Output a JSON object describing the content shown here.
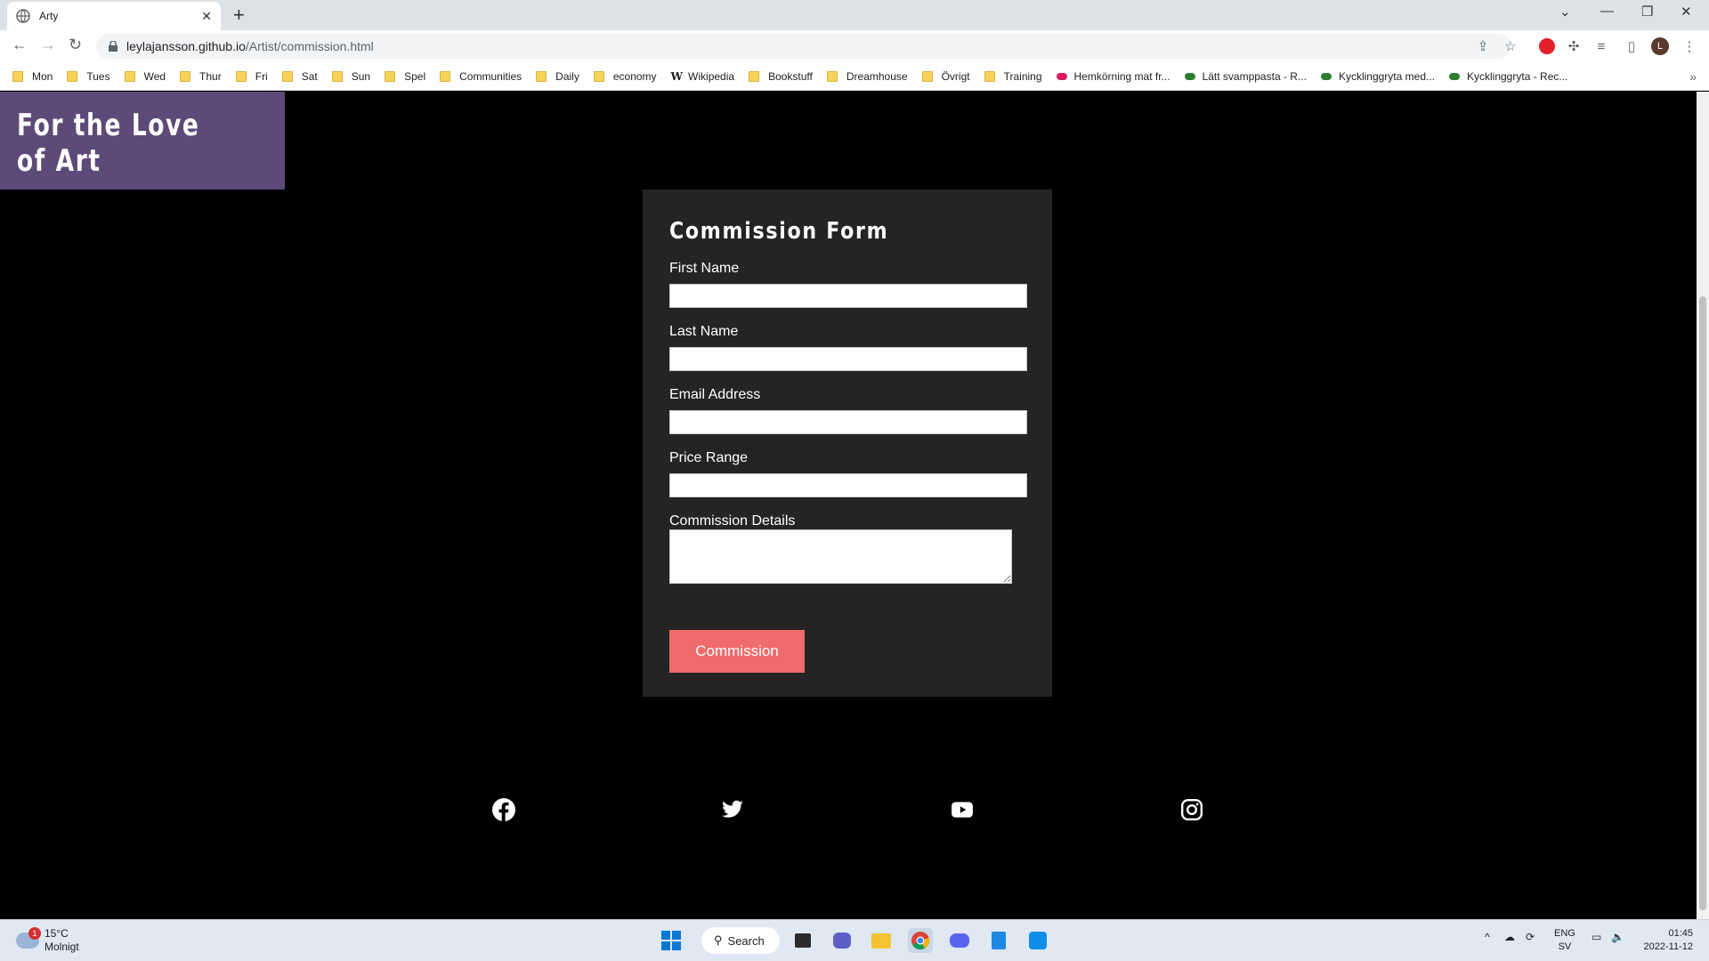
{
  "browser": {
    "tab_title": "Arty",
    "new_tab": "+",
    "url_host": "leylajansson.github.io",
    "url_path": "/Artist/commission.html",
    "window_controls": [
      "⌄",
      "—",
      "❐",
      "✕"
    ]
  },
  "bookmarks": [
    {
      "label": "Mon",
      "type": "folder"
    },
    {
      "label": "Tues",
      "type": "folder"
    },
    {
      "label": "Wed",
      "type": "folder"
    },
    {
      "label": "Thur",
      "type": "folder"
    },
    {
      "label": "Fri",
      "type": "folder"
    },
    {
      "label": "Sat",
      "type": "folder"
    },
    {
      "label": "Sun",
      "type": "folder"
    },
    {
      "label": "Spel",
      "type": "folder"
    },
    {
      "label": "Communities",
      "type": "folder"
    },
    {
      "label": "Daily",
      "type": "folder"
    },
    {
      "label": "economy",
      "type": "folder"
    },
    {
      "label": "Wikipedia",
      "type": "wiki"
    },
    {
      "label": "Bookstuff",
      "type": "folder"
    },
    {
      "label": "Dreamhouse",
      "type": "folder"
    },
    {
      "label": "Övrigt",
      "type": "folder"
    },
    {
      "label": "Training",
      "type": "folder"
    },
    {
      "label": "Hemkörning mat fr...",
      "type": "site-pink"
    },
    {
      "label": "Lätt svamppasta - R...",
      "type": "site-green"
    },
    {
      "label": "Kycklinggryta med...",
      "type": "site-green"
    },
    {
      "label": "Kycklinggryta - Rec...",
      "type": "site-green"
    }
  ],
  "bookmarks_more": "»",
  "site": {
    "logo": "For the Love of Art"
  },
  "form": {
    "title": "Commission Form",
    "first_name_label": "First Name",
    "last_name_label": "Last Name",
    "email_label": "Email Address",
    "price_label": "Price Range",
    "details_label": "Commission Details",
    "submit_label": "Commission"
  },
  "social": [
    "facebook-icon",
    "twitter-icon",
    "youtube-icon",
    "instagram-icon"
  ],
  "taskbar": {
    "weather_temp": "15°C",
    "weather_desc": "Molnigt",
    "weather_badge": "1",
    "search_label": "Search",
    "lang_top": "ENG",
    "lang_bottom": "SV",
    "time": "01:45",
    "date": "2022-11-12"
  }
}
